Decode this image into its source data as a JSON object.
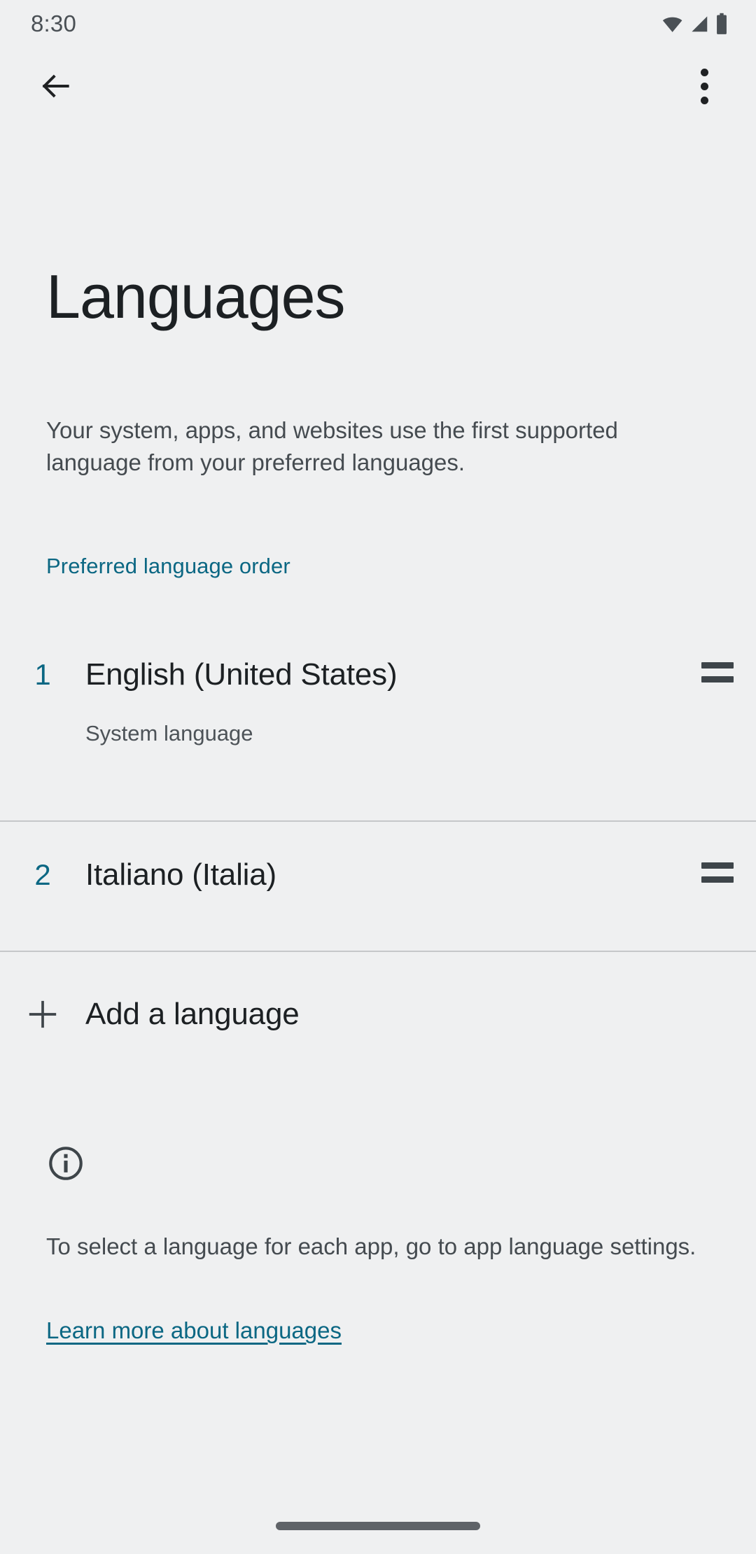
{
  "status_bar": {
    "time": "8:30",
    "icons": [
      "wifi-icon",
      "signal-icon",
      "battery-icon"
    ]
  },
  "action_bar": {
    "back_icon": "back-arrow-icon",
    "overflow_icon": "more-options-icon"
  },
  "header": {
    "title": "Languages",
    "description": "Your system, apps, and websites use the first supported language from your preferred languages."
  },
  "section": {
    "label": "Preferred language order",
    "accent_color": "#0b6783"
  },
  "languages": [
    {
      "index": "1",
      "name": "English (United States)",
      "subtitle": "System language",
      "drag_icon": "drag-handle-icon"
    },
    {
      "index": "2",
      "name": "Italiano (Italia)",
      "subtitle": "",
      "drag_icon": "drag-handle-icon"
    }
  ],
  "add_language": {
    "label": "Add a language",
    "icon": "plus-icon"
  },
  "footer": {
    "icon": "info-circle-icon",
    "text": "To select a language for each app, go to app language settings.",
    "link": "Learn more about languages"
  },
  "nav": {
    "gesture_pill": "home-gesture-pill"
  },
  "colors": {
    "background": "#eff0f1",
    "text_primary": "#1c2023",
    "text_secondary": "#454b50",
    "accent": "#0b6783",
    "divider": "#c5c7c9"
  }
}
